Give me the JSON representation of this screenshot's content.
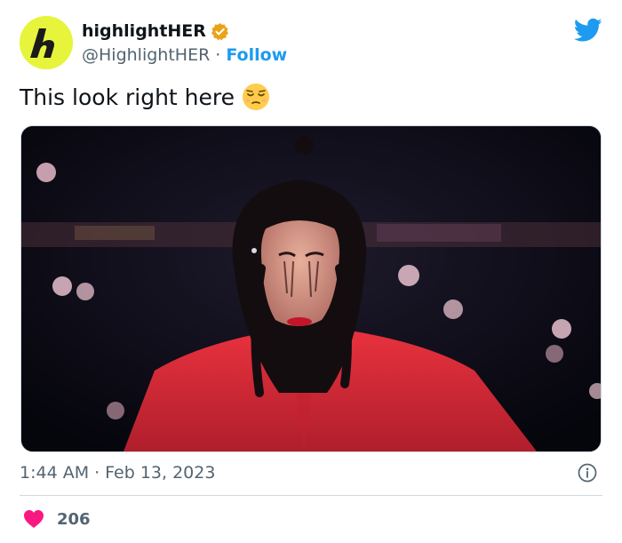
{
  "author": {
    "display_name": "highlightHER",
    "handle": "@HighlightHER",
    "separator": "·",
    "follow_label": "Follow",
    "avatar_letter": "h",
    "avatar_color": "#e6f53c",
    "verified_color": "#e8a317"
  },
  "tweet": {
    "text": "This look right here",
    "emoji": "relieved-face"
  },
  "meta": {
    "time": "1:44 AM",
    "separator": "·",
    "date": "Feb 13, 2023"
  },
  "engagement": {
    "likes": "206"
  },
  "colors": {
    "twitter_blue": "#1d9bf0",
    "heart": "#f91880",
    "muted": "#536471"
  }
}
